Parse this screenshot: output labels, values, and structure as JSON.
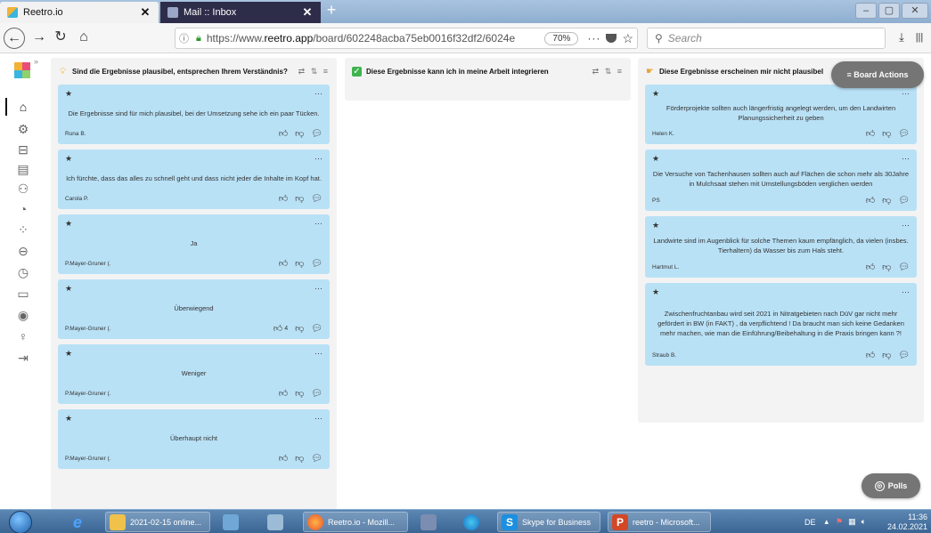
{
  "browser": {
    "tabs": [
      {
        "label": "Reetro.io",
        "close": "✕"
      },
      {
        "label": "Mail :: Inbox",
        "close": "✕"
      }
    ],
    "new_tab": "+",
    "url_prefix": "https://www.",
    "url_domain": "reetro.app",
    "url_path": "/board/602248acba75eb0016f32df2/6024e",
    "zoom": "70%",
    "more": "···",
    "search_placeholder": "Search"
  },
  "columns": [
    {
      "title": "Sind die Ergebnisse plausibel, entsprechen Ihrem Verständnis?",
      "icon_color": "#f2b233",
      "cards": [
        {
          "text": "Die Ergebnisse sind für mich plausibel, bei der Umsetzung sehe ich ein paar Tücken.",
          "author": "Runa B.",
          "votes": ""
        },
        {
          "text": "Ich fürchte, dass das alles zu schnell geht und dass nicht jeder die Inhalte im Kopf hat.",
          "author": "Carola P.",
          "votes": ""
        },
        {
          "text": "Ja",
          "author": "P.Mayer-Gruner (.",
          "votes": ""
        },
        {
          "text": "Überwiegend",
          "author": "P.Mayer-Gruner (.",
          "votes": "4"
        },
        {
          "text": "Weniger",
          "author": "P.Mayer-Gruner (.",
          "votes": ""
        },
        {
          "text": "Überhaupt nicht",
          "author": "P.Mayer-Gruner (.",
          "votes": ""
        }
      ]
    },
    {
      "title": "Diese Ergebnisse kann ich in meine Arbeit integrieren",
      "icon_color": "#3fb34f",
      "cards": []
    },
    {
      "title": "Diese Ergebnisse erscheinen mir nicht plausibel",
      "icon_color": "#e8a33a",
      "cards": [
        {
          "text": "Förderprojekte sollten auch längerfristig angelegt werden, um den Landwirten Planungssicherheit zu geben",
          "author": "Helen K.",
          "votes": ""
        },
        {
          "text": "Die Versuche von Tachenhausen sollten auch auf Flächen die schon mehr als 30Jahre in Mulchsaat stehen mit Umstellungsböden verglichen werden",
          "author": "PS",
          "votes": ""
        },
        {
          "text": "Landwirte sind im Augenblick für solche Themen kaum empfänglich, da vielen (insbes. Tierhaltern) da Wasser bis zum Hals steht.",
          "author": "Hartmut L.",
          "votes": ""
        },
        {
          "text": "Zwischenfruchtanbau wird seit 2021 in Nitratgebieten nach DüV gar nicht mehr gefördert in BW (in FAKT) , da verpflichtend ! Da braucht man sich keine Gedanken mehr machen, wie man die Einführung/Beibehaltung in die Praxis bringen kann ?!",
          "author": "Straub B.",
          "votes": ""
        }
      ]
    }
  ],
  "board_actions": "≡ Board Actions",
  "polls": "Polls",
  "taskbar": {
    "items": [
      {
        "label": "2021-02-15 online..."
      },
      {
        "label": "Reetro.io - Mozill..."
      },
      {
        "label": "Skype for Business"
      },
      {
        "label": "reetro - Microsoft..."
      }
    ],
    "lang": "DE",
    "time": "11:36",
    "date": "24.02.2021"
  }
}
